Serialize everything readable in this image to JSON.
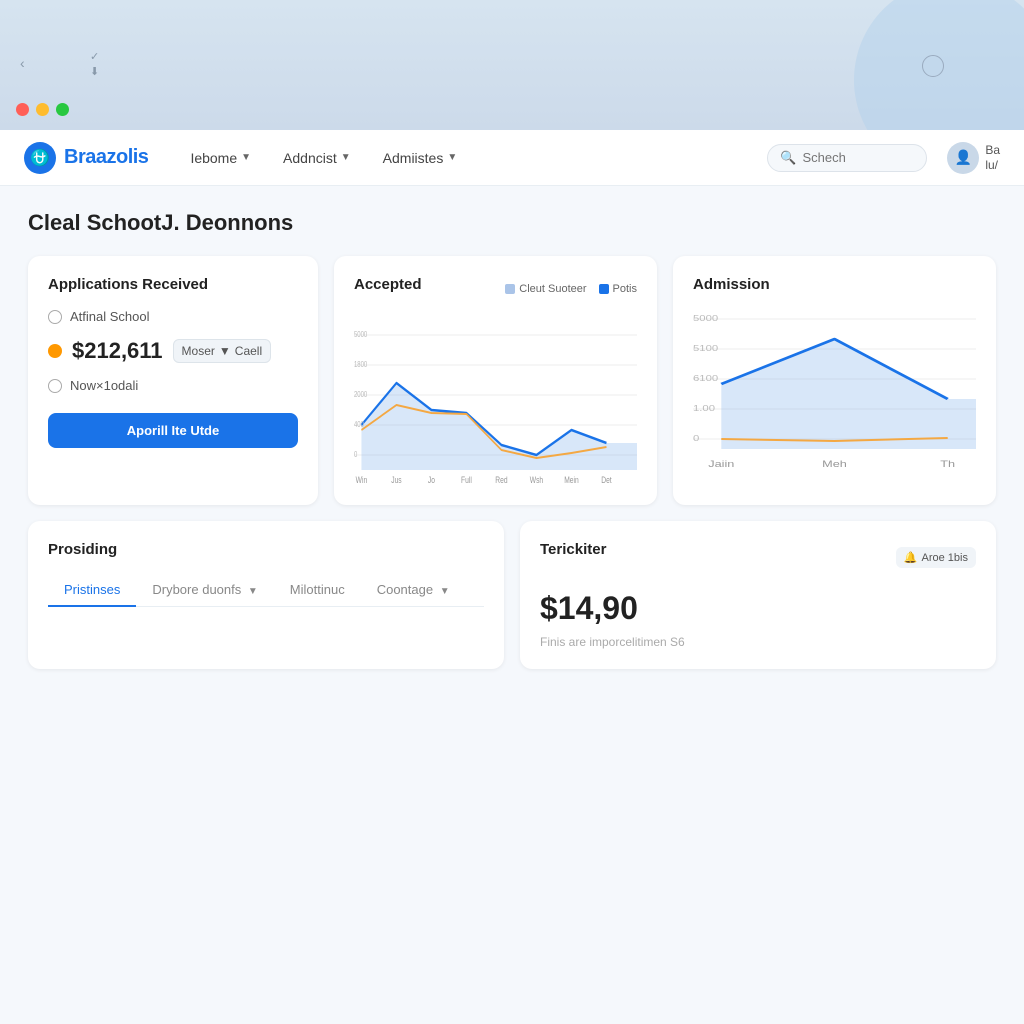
{
  "window": {
    "mac_chrome_visible": true
  },
  "navbar": {
    "logo_text": "Braazolis",
    "nav_items": [
      {
        "label": "Iebome",
        "has_dropdown": true
      },
      {
        "label": "Addncist",
        "has_dropdown": true
      },
      {
        "label": "Admiistes",
        "has_dropdown": true
      }
    ],
    "search_placeholder": "Schech",
    "avatar_initials": "Ba",
    "avatar_subtitle": "lu/"
  },
  "page": {
    "title": "Cleal SchootJ. Deonnons"
  },
  "applications_card": {
    "title": "Applications Received",
    "radio1_label": "Atfinal School",
    "radio2_label": "$212,611",
    "radio3_label": "Now×1odali",
    "filter_label": "Moser",
    "filter_icon": "▼",
    "filter2_label": "Caell",
    "action_label": "Aporill Ite Utde"
  },
  "accepted_card": {
    "title": "Accepted",
    "legend1": "Cleut Suoteer",
    "legend2": "Potis",
    "x_labels": [
      "Win",
      "Jus",
      "Jo",
      "Full",
      "Red",
      "Wsh",
      "Mein",
      "Det"
    ],
    "y_max": 5000,
    "y_labels": [
      "5000",
      "1800",
      "2000",
      "400",
      "0"
    ],
    "blue_data": [
      1800,
      3200,
      2400,
      2200,
      800,
      400,
      1600,
      900
    ],
    "orange_data": [
      1600,
      2200,
      2000,
      2100,
      600,
      300,
      500,
      700
    ]
  },
  "admission_card": {
    "title": "Admission",
    "x_labels": [
      "Jaiin",
      "Meh",
      "Th"
    ],
    "y_max": 5000,
    "y_labels": [
      "5000",
      "5100",
      "6100",
      "1.00",
      "0"
    ],
    "blue_data": [
      3200,
      4800,
      2200
    ],
    "orange_data": [
      400,
      300,
      500
    ]
  },
  "providing_card": {
    "title": "Prosiding",
    "tabs": [
      {
        "label": "Pristinses",
        "active": true
      },
      {
        "label": "Drybore duonfs",
        "has_dropdown": true
      },
      {
        "label": "Milottinuc",
        "active": false
      },
      {
        "label": "Coontage",
        "has_dropdown": true
      }
    ]
  },
  "terickiter_card": {
    "title": "Terickiter",
    "badge_icon": "🔔",
    "badge_label": "Aroe 1bis",
    "amount": "$14,90",
    "subtitle": "Finis are imporcelitimen S6"
  }
}
